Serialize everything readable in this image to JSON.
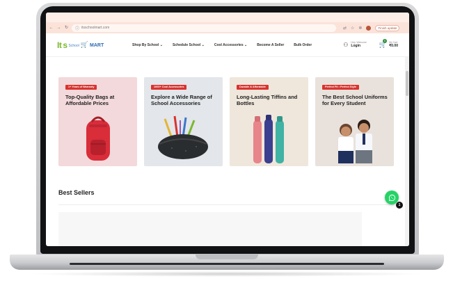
{
  "browser": {
    "url": "itsschoolmart.com",
    "update_label": "Finish update"
  },
  "logo": {
    "its": "It",
    "s": "s",
    "school": "School",
    "mart": "MART"
  },
  "nav": {
    "items": [
      {
        "label": "Shop By School"
      },
      {
        "label": "Schedule School"
      },
      {
        "label": "Cool Accessories"
      },
      {
        "label": "Become A Seller"
      },
      {
        "label": "Bulk Order"
      }
    ]
  },
  "account": {
    "greeting": "Hey, Welcome",
    "login": "Login"
  },
  "cart": {
    "label": "My Cart",
    "total": "₹0.00",
    "count": "0"
  },
  "cards": [
    {
      "tag": "1+ Years of Warranty",
      "title": "Top-Quality Bags at Affordable Prices",
      "bg": "#f3d9db",
      "art": "backpack"
    },
    {
      "tag": "1000+ Cool Accessories",
      "title": "Explore a Wide Range of School Accessories",
      "bg": "#e3e6ea",
      "art": "pouch"
    },
    {
      "tag": "Durable & Affordable",
      "title": "Long-Lasting Tiffins and Bottles",
      "bg": "#efe7dc",
      "art": "bottles"
    },
    {
      "tag": "Perfect Fit • Perfect Style",
      "title": "The Best School Uniforms for Every Student",
      "bg": "#e9e2dc",
      "art": "uniforms"
    }
  ],
  "best_sellers": {
    "title": "Best Sellers"
  },
  "whatsapp": {
    "badge": "1"
  },
  "colors": {
    "accent": "#d9332f",
    "brand_green": "#7cb82f",
    "brand_blue": "#2b6cb0",
    "whatsapp": "#25d366"
  }
}
